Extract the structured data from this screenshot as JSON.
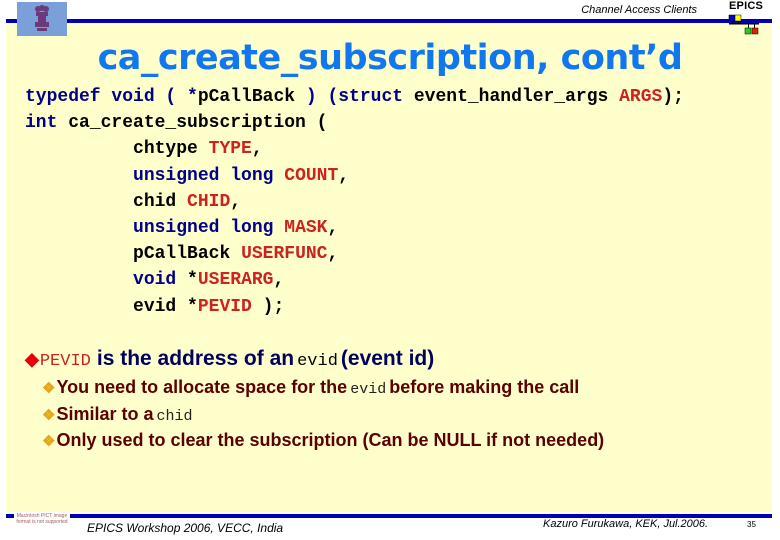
{
  "header": {
    "section_title": "Channel Access Clients",
    "logo_text": "EPICS",
    "emblem_icon": "india-state-emblem-icon",
    "logo_icon": "epics-network-logo-icon",
    "colors": {
      "rule": "#0000b0",
      "panel_bg": "#ffffcc",
      "title": "#1177ee",
      "keyword": "#00008b",
      "argument": "#cc2222"
    }
  },
  "title": "ca_create_subscription, cont’d",
  "code": {
    "lines": [
      {
        "indent": "",
        "parts": [
          {
            "t": "kw",
            "v": "typedef void ( *"
          },
          {
            "t": "tx",
            "v": "pCallBack"
          },
          {
            "t": "kw",
            "v": " ) (struct "
          },
          {
            "t": "tx",
            "v": "event_handler_args "
          },
          {
            "t": "ar",
            "v": "ARGS"
          },
          {
            "t": "tx",
            "v": ");"
          }
        ]
      },
      {
        "indent": "",
        "parts": [
          {
            "t": "kw",
            "v": "int "
          },
          {
            "t": "tx",
            "v": "ca_create_subscription ("
          }
        ]
      },
      {
        "indent": "          ",
        "parts": [
          {
            "t": "tx",
            "v": "chtype "
          },
          {
            "t": "ar",
            "v": "TYPE"
          },
          {
            "t": "tx",
            "v": ","
          }
        ]
      },
      {
        "indent": "          ",
        "parts": [
          {
            "t": "kw",
            "v": "unsigned long "
          },
          {
            "t": "ar",
            "v": "COUNT"
          },
          {
            "t": "tx",
            "v": ","
          }
        ]
      },
      {
        "indent": "          ",
        "parts": [
          {
            "t": "tx",
            "v": "chid "
          },
          {
            "t": "ar",
            "v": "CHID"
          },
          {
            "t": "tx",
            "v": ","
          }
        ]
      },
      {
        "indent": "          ",
        "parts": [
          {
            "t": "kw",
            "v": "unsigned long "
          },
          {
            "t": "ar",
            "v": "MASK"
          },
          {
            "t": "tx",
            "v": ","
          }
        ]
      },
      {
        "indent": "          ",
        "parts": [
          {
            "t": "tx",
            "v": "pCallBack "
          },
          {
            "t": "ar",
            "v": "USERFUNC"
          },
          {
            "t": "tx",
            "v": ","
          }
        ]
      },
      {
        "indent": "          ",
        "parts": [
          {
            "t": "kw",
            "v": "void "
          },
          {
            "t": "tx",
            "v": "*"
          },
          {
            "t": "ar",
            "v": "USERARG"
          },
          {
            "t": "tx",
            "v": ","
          }
        ]
      },
      {
        "indent": "          ",
        "parts": [
          {
            "t": "tx",
            "v": "evid *"
          },
          {
            "t": "ar",
            "v": "PEVID"
          },
          {
            "t": "tx",
            "v": " );"
          }
        ]
      }
    ]
  },
  "bullets": {
    "main": {
      "icon": "diamond-bullet-icon",
      "code_term": "PEVID",
      "text_before": "is the address of an",
      "code_mid": "evid",
      "text_after": "(event id)"
    },
    "subs": [
      {
        "icon": "star-bullet-icon",
        "text_before": "You need to allocate space for the",
        "code": "evid",
        "text_after": "before making the call"
      },
      {
        "icon": "star-bullet-icon",
        "text_before": "Similar to a",
        "code": "chid",
        "text_after": ""
      },
      {
        "icon": "star-bullet-icon",
        "text_before": "Only used to clear the subscription (Can be NULL if not needed)",
        "code": "",
        "text_after": ""
      }
    ]
  },
  "footer": {
    "image_placeholder": "Macintosh PICT image format is not supported",
    "event": "EPICS Workshop 2006, VECC, India",
    "author": "Kazuro Furukawa, KEK, Jul.2006.",
    "page_number": "35"
  }
}
